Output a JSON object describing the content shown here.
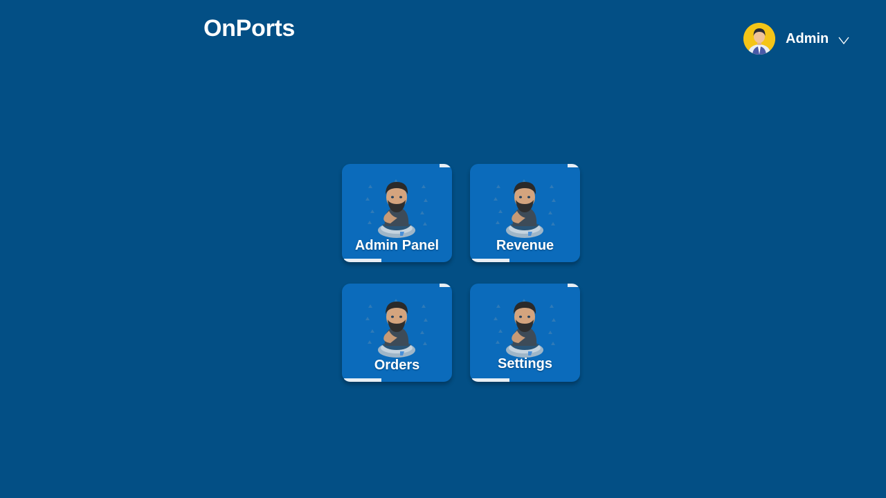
{
  "app": {
    "title": "OnPorts"
  },
  "user": {
    "name": "Admin",
    "avatar_icon": "user-avatar-icon",
    "menu_icon": "chevron-down-icon"
  },
  "tiles": [
    {
      "label": "Admin Panel",
      "icon": "thinking-man-illustration"
    },
    {
      "label": "Revenue",
      "icon": "thinking-man-illustration"
    },
    {
      "label": "Orders",
      "icon": "thinking-man-illustration"
    },
    {
      "label": "Settings",
      "icon": "thinking-man-illustration"
    }
  ],
  "colors": {
    "background": "#034f85",
    "tile": "#0b6bbb",
    "avatar_bg": "#f5c518",
    "text": "#ffffff"
  }
}
